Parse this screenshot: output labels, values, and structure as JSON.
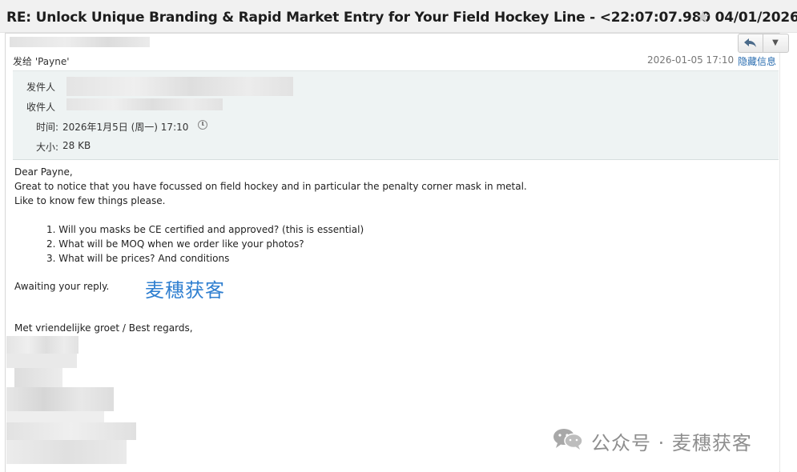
{
  "window": {
    "subject": "RE: Unlock Unique Branding & Rapid Market Entry for Your Field Hockey Line - <22:07:07.980 04/01/2026>",
    "star_icon": "star-icon"
  },
  "message": {
    "send_to": "发给 'Payne'",
    "date": "2026-01-05 17:10",
    "hide_info_label": "隐藏信息",
    "reply_icon": "reply-icon",
    "more_icon": "chevron-down-icon"
  },
  "header": {
    "from_label": "发件人",
    "to_label": "收件人",
    "time_label": "时间:",
    "time_value": "2026年1月5日 (周一) 17:10",
    "size_label": "大小:",
    "size_value": "28 KB"
  },
  "body": {
    "greeting": "Dear Payne,",
    "line1": "Great to notice that you have focussed on field hockey and in particular the penalty corner mask in metal.",
    "line2": "Like to know few things please.",
    "questions": [
      "1.  Will you masks be CE certified and approved? (this is essential)",
      "2.  What will be MOQ when we order like your photos?",
      "3.  What will be prices? And conditions"
    ],
    "closing": "Awaiting your reply.",
    "regards": "Met vriendelijke groet / Best regards,"
  },
  "watermarks": {
    "inline": "麦穗获客",
    "footer": "公众号 · 麦穗获客"
  }
}
